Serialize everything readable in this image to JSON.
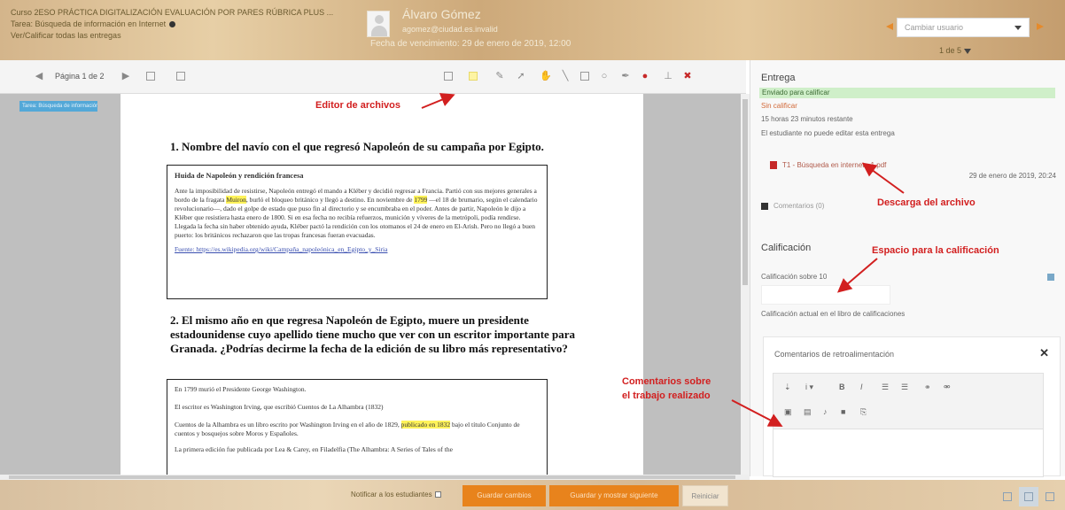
{
  "header": {
    "course_title": "Curso 2ESO PRÁCTICA DIGITALIZACIÓN EVALUACIÓN POR PARES RÚBRICA PLUS ...",
    "assignment": "Tarea: Búsqueda de información en Internet",
    "view_all": "Ver/Calificar todas las entregas",
    "user_name": "Álvaro Gómez",
    "user_email": "agomez@ciudad.es.invalid",
    "due_date": "Fecha de vencimiento: 29 de enero de 2019, 12:00",
    "change_user_placeholder": "Cambiar usuario",
    "pager": "1 de 5"
  },
  "toolbar": {
    "page_label": "Página 1 de 2"
  },
  "document": {
    "tag": "Tarea: Búsqueda de información...",
    "q1": "1.  Nombre del navío con el que regresó Napoleón de su campaña por Egipto.",
    "box1_title": "Huida de Napoleón y rendición francesa",
    "box1_p1_a": "Ante la imposibilidad de resistirse, Napoleón entregó el mando a Kléber y decidió regresar a Francia. Partió con sus mejores generales a bordo de la fragata ",
    "box1_p1_mark": "Muiron",
    "box1_p1_b": ", burló el bloqueo británico y llegó a destino. En noviembre de ",
    "box1_p1_mark2": "1799",
    "box1_p1_c": " —el 18 de brumario, según el calendario revolucionario—, dado el golpe de estado que puso fin al directorio y se encumbraba en el poder. Antes de partir, Napoleón le dijo a Kléber que resistiera hasta enero de 1800. Si en esa fecha no recibía refuerzos, munición y víveres de la metrópoli, podía rendirse. Llegada la fecha sin haber obtenido ayuda, Kléber pactó la rendición con los otomanos el 24 de enero en El-Arish. Pero no llegó a buen puerto: los británicos rechazaron que las tropas francesas fueran evacuadas.",
    "box1_source": "Fuente: https://es.wikipedia.org/wiki/Campaña_napoleónica_en_Egipto_y_Siria",
    "q2": "2.  El mismo año en que regresa Napoleón de Egipto, muere un presidente estadounidense cuyo apellido tiene mucho que ver con un escritor importante para Granada. ¿Podrías decirme la fecha de la edición de su libro más representativo?",
    "box2_l1": "En 1799 murió el Presidente George Washington.",
    "box2_l2": "El escritor es Washington Irving, que escribió Cuentos de La Alhambra (1832)",
    "box2_l3_a": "Cuentos de la Alhambra es un libro escrito por Washington Irving en el año de 1829, ",
    "box2_l3_mark": "publicado en 1832",
    "box2_l3_b": " bajo el título Conjunto de cuentos y bosquejos sobre Moros y Españoles.",
    "box2_l4": "La primera edición fue publicada por Lea & Carey, en Filadelfia (The Alhambra: A Series of Tales of the"
  },
  "annotations": {
    "editor": "Editor de archivos",
    "download": "Descarga del archivo",
    "grade_space": "Espacio para la calificación",
    "comments_1": "Comentarios sobre",
    "comments_2": "el trabajo realizado"
  },
  "panel": {
    "submission_heading": "Entrega",
    "status": "Enviado para calificar",
    "not_graded": "Sin calificar",
    "time_left": "15 horas 23 minutos restante",
    "cannot_edit": "El estudiante no puede editar esta entrega",
    "file_name": "T1 - Búsqueda en internet - 1.pdf",
    "file_date": "29 de enero de 2019, 20:24",
    "comments_link": "Comentarios (0)",
    "grade_heading": "Calificación",
    "grade_out_of": "Calificación sobre 10",
    "current_grade": "Calificación actual en el libro de calificaciones",
    "feedback_title": "Comentarios de retroalimentación"
  },
  "footer": {
    "notify": "Notificar a los estudiantes",
    "save": "Guardar cambios",
    "save_next": "Guardar y mostrar siguiente",
    "reset": "Reiniciar"
  },
  "colors": {
    "accent": "#e8831c",
    "annotation": "#d21f1f",
    "status_bg": "#cfefc9"
  }
}
